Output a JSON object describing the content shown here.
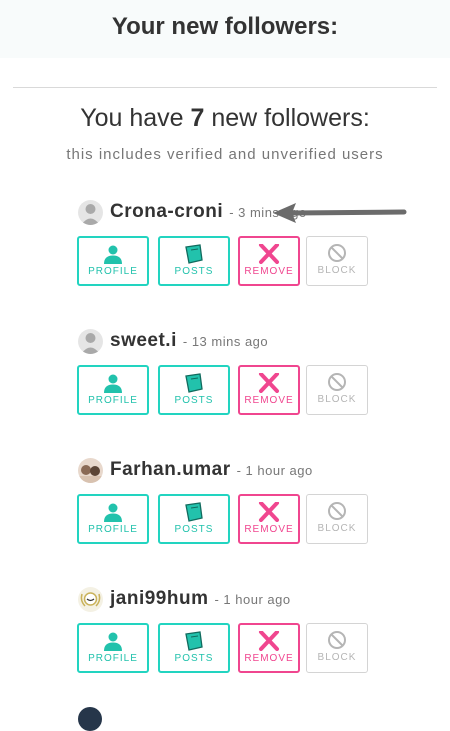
{
  "header": {
    "title": "Your new followers:"
  },
  "summary": {
    "prefix": "You have",
    "count": "7",
    "suffix": "new followers:",
    "subtext": "this includes verified and unverified users"
  },
  "buttons": {
    "profile": "PROFILE",
    "posts": "POSTS",
    "remove": "REMOVE",
    "block": "BLOCK"
  },
  "followers": [
    {
      "name": "Crona-croni",
      "time": "- 3 mins ago"
    },
    {
      "name": "sweet.i",
      "time": "- 13 mins ago"
    },
    {
      "name": "Farhan.umar",
      "time": "- 1 hour ago"
    },
    {
      "name": "jani99hum",
      "time": "- 1 hour ago"
    }
  ],
  "colors": {
    "accent": "#22d4c0",
    "remove": "#f0468f",
    "disabled": "#b5b5b5",
    "text": "#333333"
  }
}
